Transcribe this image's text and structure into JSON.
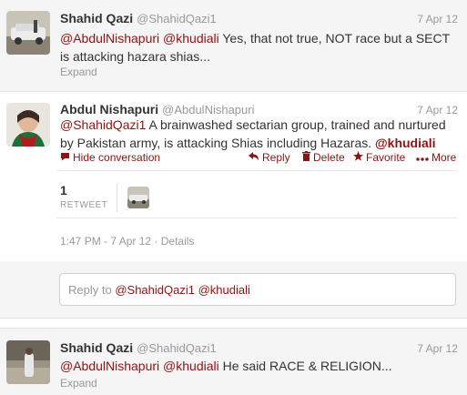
{
  "tweets": [
    {
      "name": "Shahid Qazi",
      "handle": "@ShahidQazi1",
      "date": "7 Apr 12",
      "mentions": [
        "@AbdulNishapuri",
        "@khudiali"
      ],
      "text": "Yes, that not true, NOT race but a SECT is attacking hazara shias...",
      "expand": "Expand"
    },
    {
      "name": "Abdul Nishapuri",
      "handle": "@AbdulNishapuri",
      "date": "7 Apr 12",
      "mention_start": "@ShahidQazi1",
      "text": "A brainwashed sectarian group, trained and nurtured by Pakistan army, is attacking Shias including Hazaras.",
      "mention_end": "@khudiali",
      "actions": {
        "hide": "Hide conversation",
        "reply": "Reply",
        "delete": "Delete",
        "favorite": "Favorite",
        "more": "More"
      },
      "retweet_count": "1",
      "retweet_label": "RETWEET",
      "timestamp": "1:47 PM - 7 Apr 12",
      "details": "Details"
    },
    {
      "name": "Shahid Qazi",
      "handle": "@ShahidQazi1",
      "date": "7 Apr 12",
      "mentions": [
        "@AbdulNishapuri",
        "@khudiali"
      ],
      "text": "He said RACE & RELIGION...",
      "expand": "Expand"
    }
  ],
  "reply_box": {
    "prefix": "Reply to",
    "mentions": [
      "@ShahidQazi1",
      "@khudiali"
    ]
  },
  "colors": {
    "link": "#8b1414",
    "muted": "#999999",
    "panel": "#f5f5f5"
  }
}
